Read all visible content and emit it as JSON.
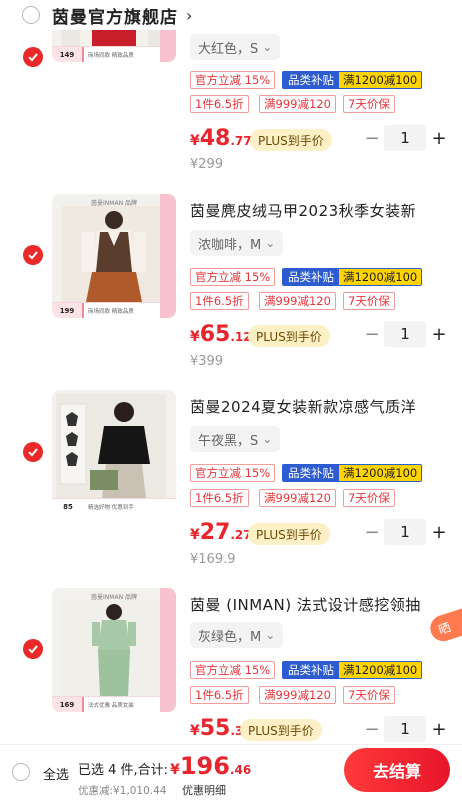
{
  "shop": {
    "name": "茵曼官方旗舰店"
  },
  "tags": {
    "instant": "官方立减",
    "instant_pct": "15%",
    "subsidy": "品类补贴",
    "coupon": "满1200减100",
    "discount": "1件6.5折",
    "threshold": "满999减120",
    "returns": "7天价保",
    "plus": "PLUS到手价"
  },
  "items": [
    {
      "title": "",
      "variant": "大红色，S",
      "price_int": "48",
      "price_dec": ".77",
      "currency": "¥",
      "original": "¥299",
      "qty": "1",
      "thumb_price": "149",
      "thumb_text": "商场同款 精致品质",
      "checked": true
    },
    {
      "title": "茵曼麂皮绒马甲2023秋季女装新",
      "variant": "浓咖啡，M",
      "price_int": "65",
      "price_dec": ".12",
      "currency": "¥",
      "original": "¥399",
      "qty": "1",
      "thumb_price": "199",
      "thumb_text": "商场同款 精致品质",
      "thumb_brand": "茵曼INMAN 品牌",
      "checked": true
    },
    {
      "title": "茵曼2024夏女装新款凉感气质洋",
      "variant": "午夜黑，S",
      "price_int": "27",
      "price_dec": ".27",
      "currency": "¥",
      "original": "¥169.9",
      "qty": "1",
      "thumb_price": "85",
      "thumb_text": "精选好物 优惠到手",
      "checked": true
    },
    {
      "title": "茵曼 (INMAN) 法式设计感挖领抽",
      "variant": "灰绿色，M",
      "price_int": "55",
      "price_dec": ".3",
      "currency": "¥",
      "original": "",
      "qty": "1",
      "thumb_price": "169",
      "thumb_text": "法式优雅 品质女装",
      "thumb_brand": "茵曼INMAN 品牌",
      "ribbon": "晒",
      "checked": true
    }
  ],
  "bottom": {
    "select_all": "全选",
    "chosen": "已选 4 件,合计:",
    "currency": "¥",
    "total_int": "196",
    "total_dec": ".46",
    "discount": "优惠减:¥1,010.44",
    "detail": "优惠明细",
    "checkout": "去结算"
  },
  "colors": {
    "accent": "#e8252c",
    "blue_tag": "#2d5bd0",
    "yellow_tag": "#ffd400",
    "plus_bg": "#fdf0c6"
  }
}
